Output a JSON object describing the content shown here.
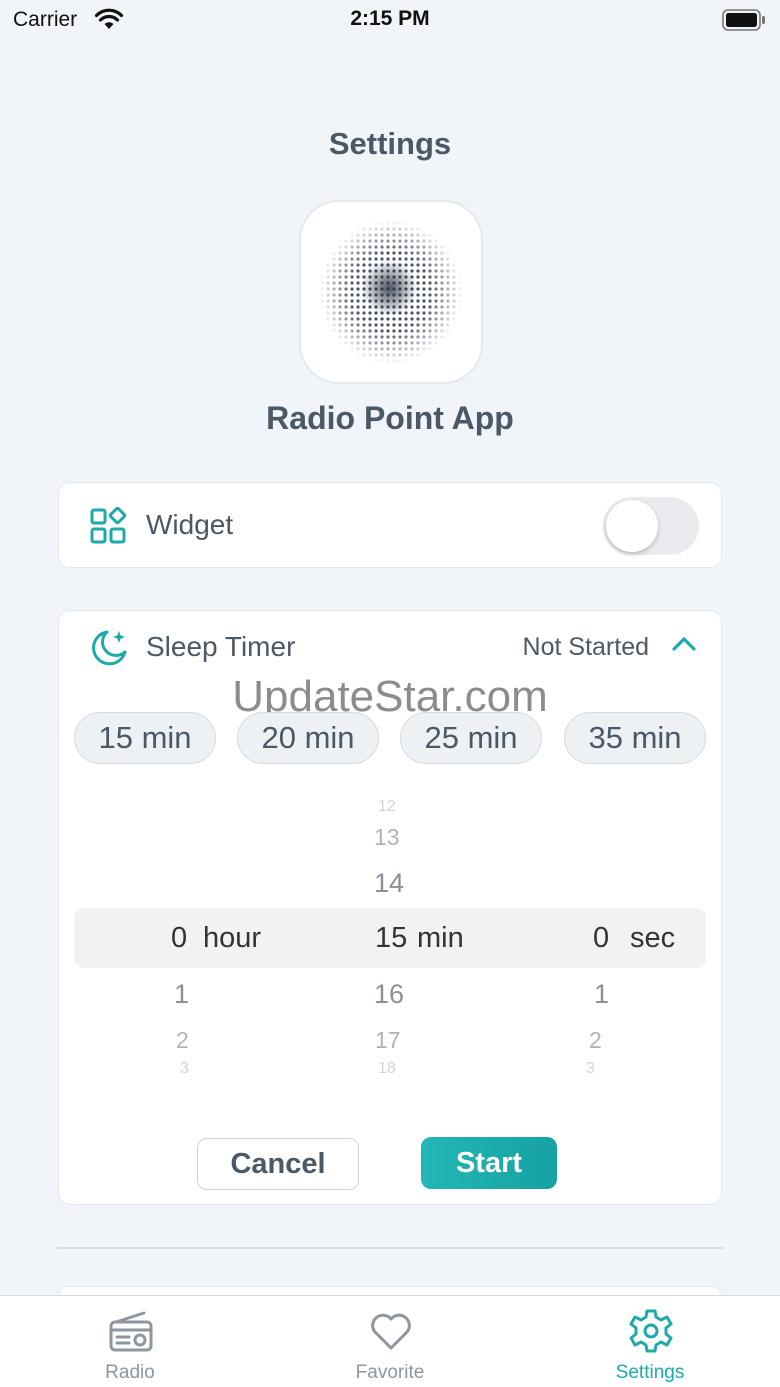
{
  "status_bar": {
    "carrier": "Carrier",
    "time": "2:15 PM"
  },
  "header": {
    "title": "Settings"
  },
  "app": {
    "name": "Radio Point App"
  },
  "widget": {
    "label": "Widget",
    "enabled": false
  },
  "sleep_timer": {
    "label": "Sleep Timer",
    "status": "Not Started",
    "presets": [
      "15 min",
      "20 min",
      "25 min",
      "35 min"
    ],
    "picker": {
      "hour": {
        "selected": "0",
        "unit": "hour",
        "above": [],
        "below": [
          "1",
          "2",
          "3"
        ]
      },
      "min": {
        "selected": "15",
        "unit": "min",
        "above": [
          "12",
          "13",
          "14"
        ],
        "below": [
          "16",
          "17",
          "18"
        ]
      },
      "sec": {
        "selected": "0",
        "unit": "sec",
        "above": [],
        "below": [
          "1",
          "2",
          "3"
        ]
      }
    },
    "cancel_label": "Cancel",
    "start_label": "Start"
  },
  "watermark": "UpdateStar.com",
  "tabs": [
    {
      "label": "Radio",
      "icon": "radio-icon",
      "active": false
    },
    {
      "label": "Favorite",
      "icon": "heart-icon",
      "active": false
    },
    {
      "label": "Settings",
      "icon": "gear-icon",
      "active": true
    }
  ],
  "colors": {
    "accent": "#1ea9aa",
    "background": "#f1f4f8",
    "text": "#4b5866"
  }
}
